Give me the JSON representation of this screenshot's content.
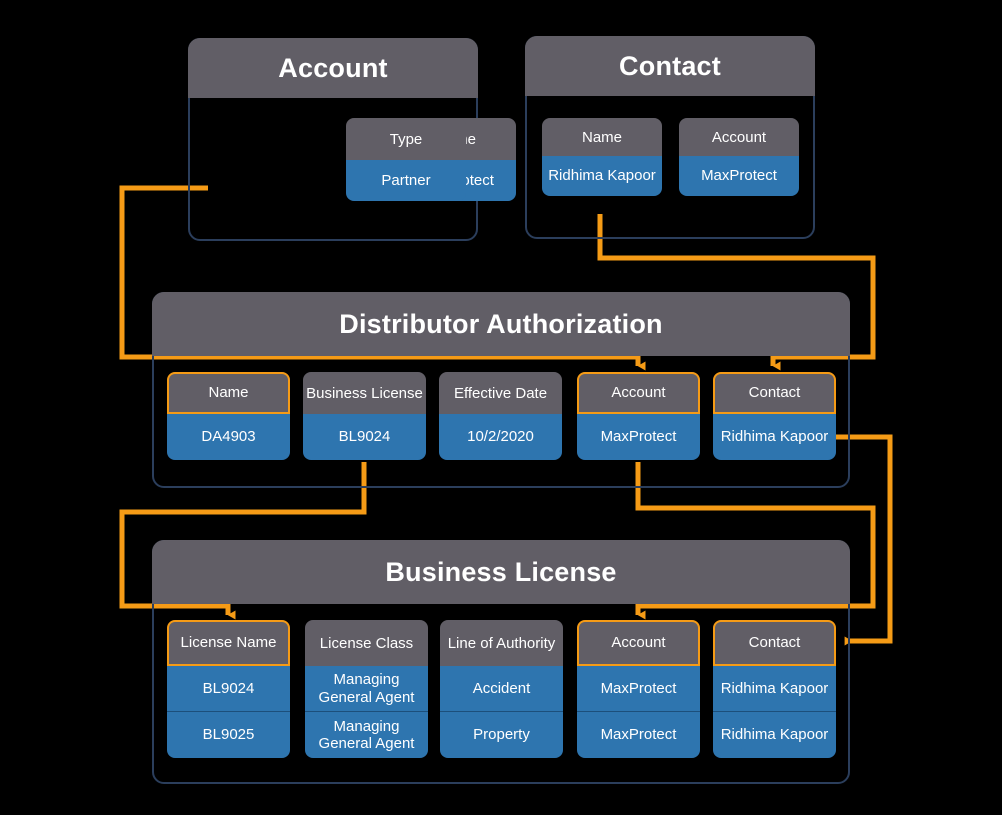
{
  "accent": {
    "connector": "#f59b16",
    "header_gray": "#615e66",
    "value_blue": "#2e75af",
    "card_border": "#2b3e5c",
    "background": "#000000"
  },
  "entities": [
    {
      "id": "account",
      "title": "Account",
      "fields": [
        {
          "label": "Name",
          "highlight": false,
          "values": [
            "MaxProtect"
          ]
        },
        {
          "label": "Type",
          "highlight": false,
          "values": [
            "Partner"
          ]
        }
      ]
    },
    {
      "id": "contact",
      "title": "Contact",
      "fields": [
        {
          "label": "Name",
          "highlight": false,
          "values": [
            "Ridhima Kapoor"
          ]
        },
        {
          "label": "Account",
          "highlight": false,
          "values": [
            "MaxProtect"
          ]
        }
      ]
    },
    {
      "id": "distributor-authorization",
      "title": "Distributor Authorization",
      "fields": [
        {
          "label": "Name",
          "highlight": true,
          "values": [
            "DA4903"
          ]
        },
        {
          "label": "Business License",
          "highlight": false,
          "values": [
            "BL9024"
          ]
        },
        {
          "label": "Effective Date",
          "highlight": false,
          "values": [
            "10/2/2020"
          ]
        },
        {
          "label": "Account",
          "highlight": true,
          "values": [
            "MaxProtect"
          ]
        },
        {
          "label": "Contact",
          "highlight": true,
          "values": [
            "Ridhima Kapoor"
          ]
        }
      ]
    },
    {
      "id": "business-license",
      "title": "Business License",
      "fields": [
        {
          "label": "License Name",
          "highlight": true,
          "values": [
            "BL9024",
            "BL9025"
          ]
        },
        {
          "label": "License Class",
          "highlight": false,
          "values": [
            "Managing General Agent",
            "Managing General Agent"
          ]
        },
        {
          "label": "Line of Authority",
          "highlight": false,
          "values": [
            "Accident",
            "Property"
          ]
        },
        {
          "label": "Account",
          "highlight": true,
          "values": [
            "MaxProtect",
            "MaxProtect"
          ]
        },
        {
          "label": "Contact",
          "highlight": true,
          "values": [
            "Ridhima Kapoor",
            "Ridhima Kapoor"
          ]
        }
      ]
    }
  ],
  "connections": [
    {
      "id": "account-name-to-da-account",
      "from": "Account.Name = MaxProtect",
      "to": "Distributor Authorization.Account"
    },
    {
      "id": "contact-name-to-da-contact",
      "from": "Contact.Name = Ridhima Kapoor",
      "to": "Distributor Authorization.Contact"
    },
    {
      "id": "da-business-license-to-bl-license-name",
      "from": "Distributor Authorization.Business License = BL9024",
      "to": "Business License.License Name"
    },
    {
      "id": "da-account-to-bl-account",
      "from": "Distributor Authorization.Account = MaxProtect",
      "to": "Business License.Account"
    },
    {
      "id": "da-contact-to-bl-contact",
      "from": "Distributor Authorization.Contact = Ridhima Kapoor",
      "to": "Business License.Contact"
    }
  ]
}
